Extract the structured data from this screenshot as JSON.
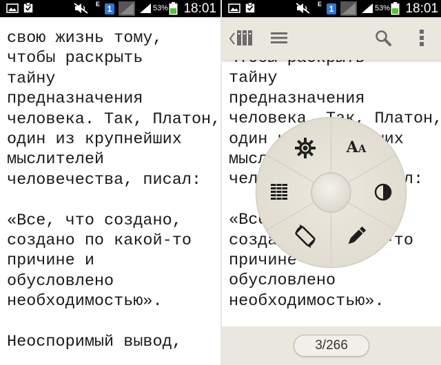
{
  "status_bar": {
    "icons": [
      "gallery-icon",
      "clipboard-check-icon",
      "mute-icon",
      "sim-1-icon",
      "signal-icon",
      "battery-icon"
    ],
    "battery_percent": "53%",
    "time": "18:01",
    "sim_label": "1",
    "network_label": "E"
  },
  "left_pane": {
    "text_lines": [
      "свою жизнь тому,",
      "чтобы раскрыть",
      "тайну",
      "предназначения",
      "человека. Так, Платон,",
      "один из крупнейших",
      "мыслителей",
      "человечества, писал:",
      "",
      "«Все, что создано,",
      "создано по какой-то",
      "причине и",
      "обусловлено",
      "необходимостью».",
      "",
      "Неоспоримый вывод,"
    ]
  },
  "right_pane": {
    "text_lines": [
      "чтобы раскрыть",
      "тайну",
      "предназначения",
      "человека. Так, Платон,",
      "один из крупнейших",
      "мыслителей",
      "человечества, писал:",
      "",
      "«Все, что создано,",
      "создано по какой-то",
      "причине и",
      "обусловлено",
      "необходимостью»."
    ],
    "toolbar": {
      "icons": [
        "back-chevron-icon",
        "library-icon",
        "table-of-contents-icon",
        "search-icon",
        "overflow-menu-icon"
      ]
    },
    "radial_menu": {
      "items": [
        "brightness-icon",
        "font-size-icon",
        "night-mode-icon",
        "annotate-pen-icon",
        "rotate-screen-icon",
        "page-layout-icon"
      ],
      "font_label_large": "A",
      "font_label_small": "A"
    },
    "page_indicator": "3/266"
  },
  "colors": {
    "status_bar_bg": "#000000",
    "toolbar_bg": "#eae7df",
    "menu_bg": "#e8e4da",
    "text": "#1a1a1a",
    "battery_green": "#55c22e"
  }
}
